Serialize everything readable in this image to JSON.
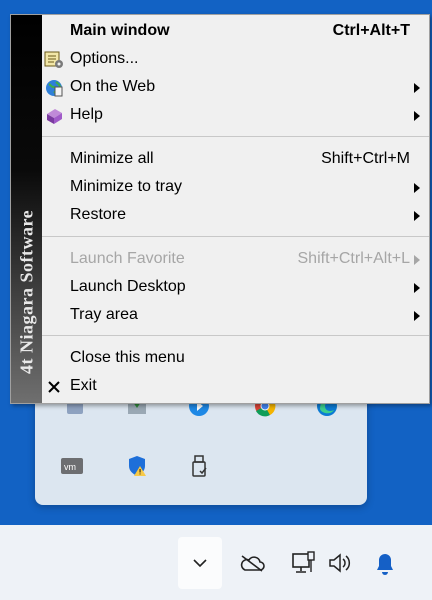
{
  "menu": {
    "sidebar_text": "4t Niagara Software",
    "main_window": {
      "label": "Main window",
      "shortcut": "Ctrl+Alt+T"
    },
    "options": {
      "label": "Options...",
      "icon": "options-icon"
    },
    "on_the_web": {
      "label": "On the Web",
      "icon": "web-icon"
    },
    "help": {
      "label": "Help",
      "icon": "help-book-icon"
    },
    "minimize_all": {
      "label": "Minimize all",
      "shortcut": "Shift+Ctrl+M"
    },
    "minimize_to_tray": {
      "label": "Minimize to tray"
    },
    "restore": {
      "label": "Restore"
    },
    "launch_favorite": {
      "label": "Launch Favorite",
      "shortcut": "Shift+Ctrl+Alt+L",
      "state": "disabled"
    },
    "launch_desktop": {
      "label": "Launch Desktop"
    },
    "tray_area": {
      "label": "Tray area"
    },
    "close_menu": {
      "label": "Close this menu"
    },
    "exit": {
      "label": "Exit",
      "icon": "close-icon"
    }
  },
  "tray_flyout": {
    "icons": [
      "tray-app-icon",
      "download-icon",
      "media-icon",
      "chrome-icon",
      "edge-icon",
      "vmware-icon",
      "security-warning-icon",
      "usb-drive-icon"
    ]
  },
  "taskbar": {
    "icons": [
      "chevron-down-icon",
      "onedrive-offline-icon",
      "network-icon",
      "volume-icon",
      "notification-bell-icon"
    ]
  },
  "colors": {
    "desktop": "#1262c4",
    "menu_bg": "#f0f0f0",
    "disabled_text": "#a6a6a6",
    "taskbar": "#eef2f7"
  }
}
